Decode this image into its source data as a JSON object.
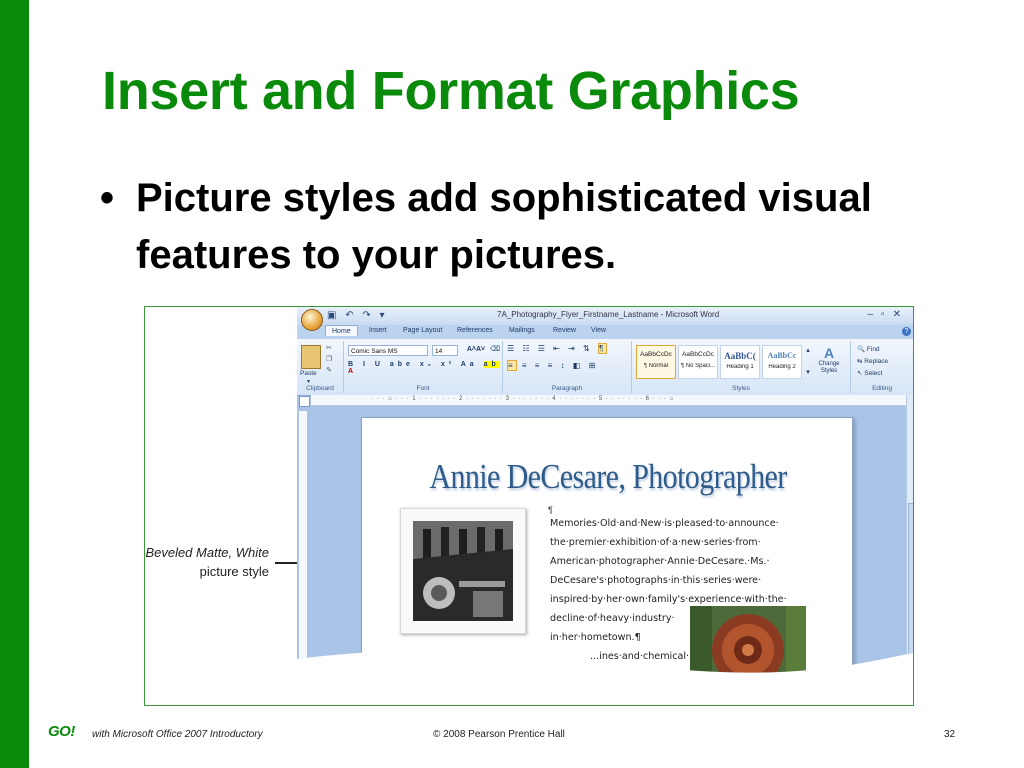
{
  "slide": {
    "title": "Insert and Format Graphics",
    "bullet": "Picture styles add sophisticated visual features to your pictures.",
    "bullet_symbol": "•",
    "callout_line1": "Beveled Matte, White",
    "callout_line2": "picture style"
  },
  "word": {
    "window_title": "7A_Photography_Flyer_Firstname_Lastname - Microsoft Word",
    "tabs": [
      "Home",
      "Insert",
      "Page Layout",
      "References",
      "Mailings",
      "Review",
      "View"
    ],
    "clipboard": {
      "paste": "Paste",
      "label": "Clipboard"
    },
    "font": {
      "name": "Comic Sans MS",
      "size": "14",
      "label": "Font"
    },
    "paragraph_label": "Paragraph",
    "styles": {
      "items": [
        {
          "sample": "AaBbCcDc",
          "name": "¶ Normal"
        },
        {
          "sample": "AaBbCcDc",
          "name": "¶ No Spaci..."
        },
        {
          "sample": "AaBbC(",
          "name": "Heading 1"
        },
        {
          "sample": "AaBbCc",
          "name": "Heading 2"
        }
      ],
      "change": "Change Styles",
      "label": "Styles"
    },
    "editing": {
      "find": "Find",
      "replace": "Replace",
      "select": "Select",
      "label": "Editing"
    }
  },
  "document": {
    "heading": "Annie DeCesare, Photographer",
    "para_mark": "¶",
    "lines": [
      "Memories·Old·and·New·is·pleased·to·announce·",
      "the·premier·exhibition·of·a·new·series·from·",
      "American·photographer·Annie·DeCesare.·Ms.·",
      "DeCesare's·photographs·in·this·series·were·",
      "inspired·by·her·own·family's·experience·with·the·",
      "decline·of·heavy·industry·",
      "in·her·hometown.¶"
    ],
    "partial_line": "...ines·and·chemical·"
  },
  "footer": {
    "logo": "GO!",
    "left": "with Microsoft Office 2007 Introductory",
    "center": "© 2008 Pearson Prentice Hall",
    "page": "32"
  },
  "colors": {
    "accent_green": "#0a8a0a",
    "word_blue": "#a9c4e6",
    "heading_blue": "#2f5c8a"
  }
}
